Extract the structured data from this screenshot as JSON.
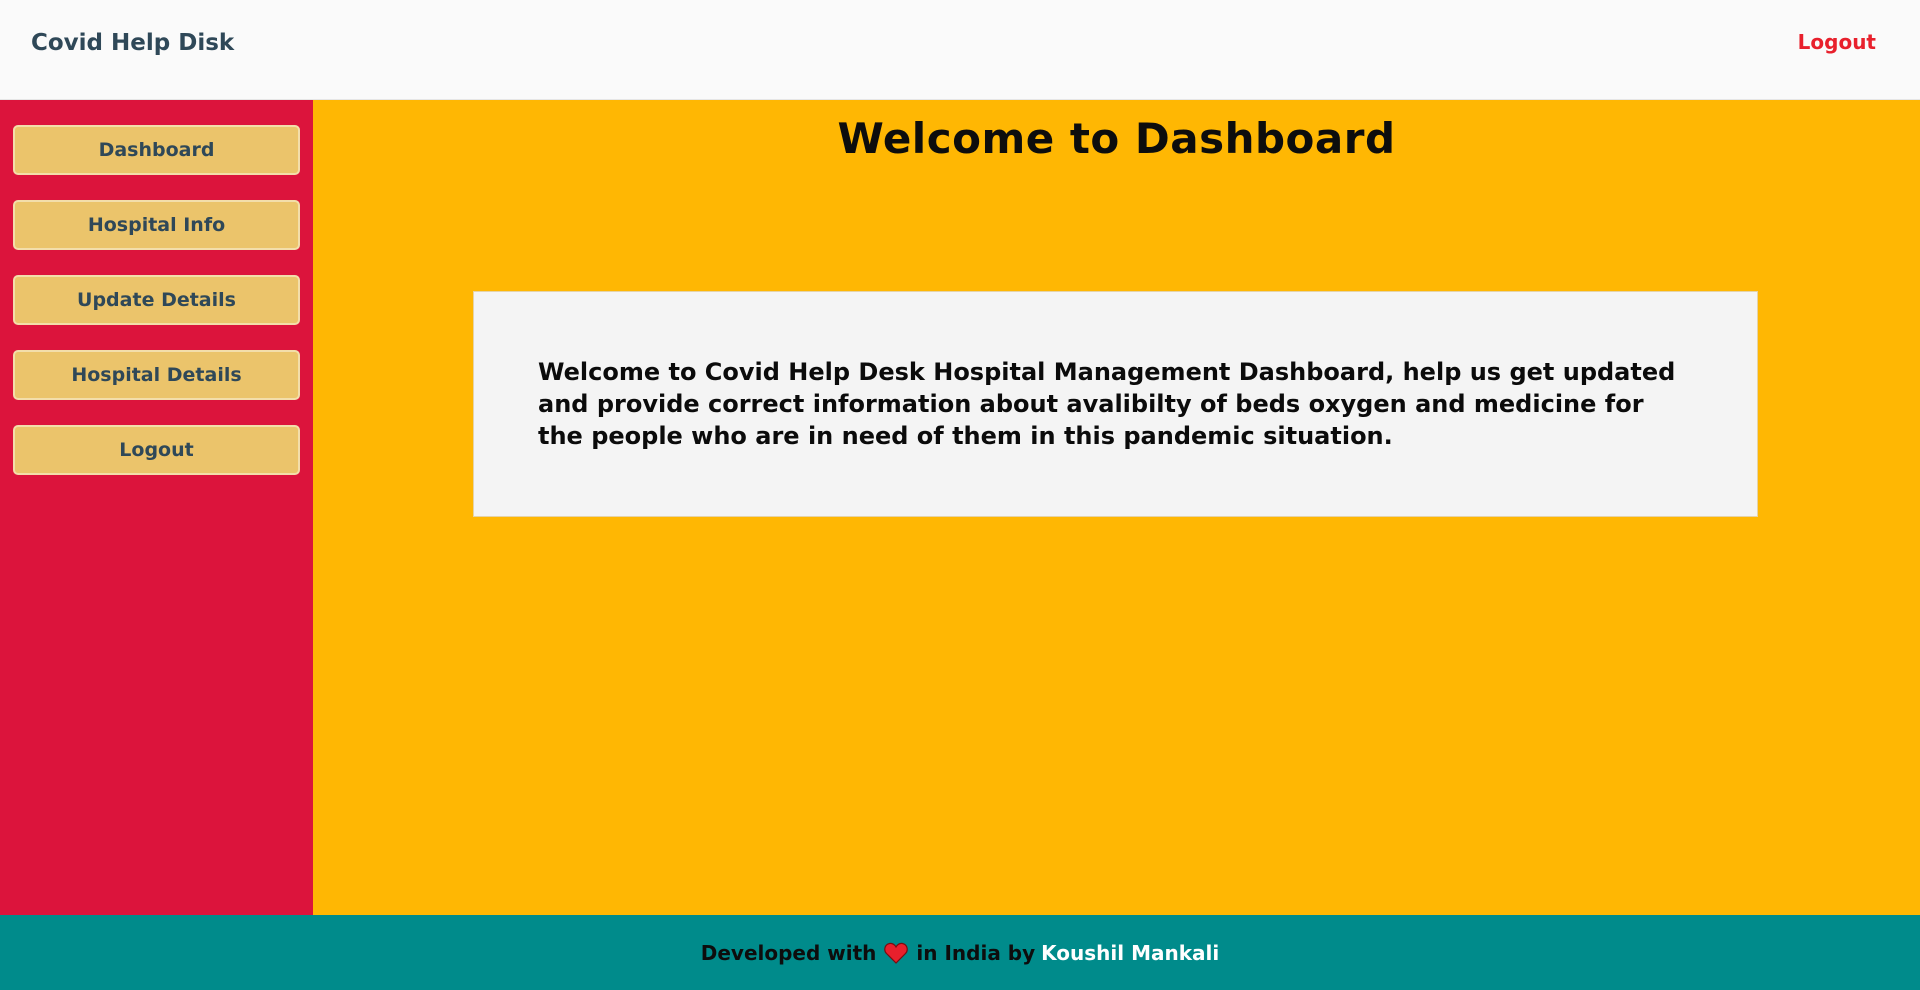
{
  "header": {
    "brand": "Covid Help Disk",
    "logout_label": "Logout"
  },
  "sidebar": {
    "items": [
      {
        "label": "Dashboard"
      },
      {
        "label": "Hospital Info"
      },
      {
        "label": "Update Details"
      },
      {
        "label": "Hospital Details"
      },
      {
        "label": "Logout"
      }
    ]
  },
  "main": {
    "title": "Welcome to Dashboard",
    "welcome_message": "Welcome to Covid Help Desk Hospital Management Dashboard, help us get updated and provide correct information about avalibilty of beds oxygen and medicine for the people who are in need of them in this pandemic situation."
  },
  "footer": {
    "prefix": "Developed with",
    "heart_icon": "heart-icon",
    "middle": "in India by",
    "author": "Koushil Mankali"
  },
  "colors": {
    "sidebar": "#dc143c",
    "main_background": "#ffb703",
    "nav_button": "#ebc46b",
    "footer": "#008b8b",
    "logout_link": "#e8202c",
    "brand": "#2f4858"
  }
}
